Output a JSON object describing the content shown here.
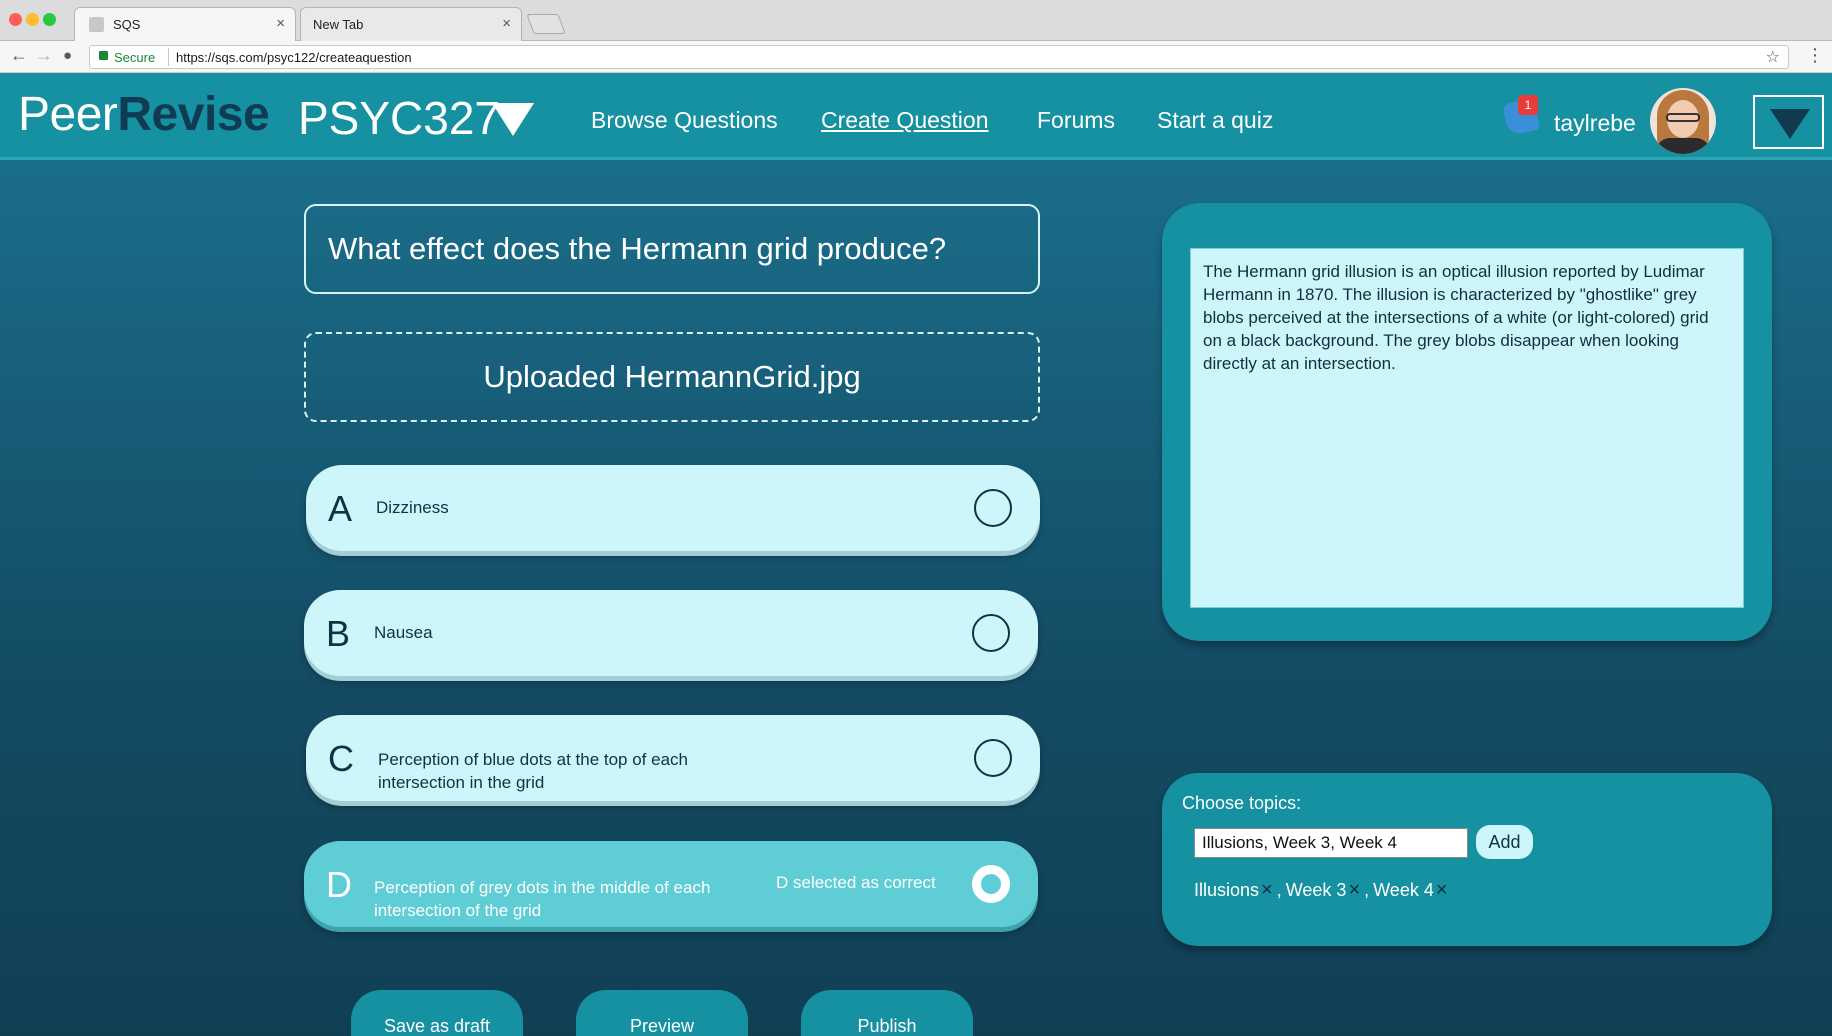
{
  "browser": {
    "tabs": [
      {
        "title": "SQS",
        "close": "×"
      },
      {
        "title": "New Tab",
        "close": "×"
      }
    ],
    "secure_label": "Secure",
    "url": "https://sqs.com/psyc122/createaquestion",
    "star": "☆",
    "menu": "⋮",
    "back": "←",
    "forward": "→",
    "reload": "●",
    "traffic_colors": [
      "#fe5f57",
      "#febc2e",
      "#28c840"
    ]
  },
  "header": {
    "logo_part1": "Peer",
    "logo_part2": "Revise",
    "course": "PSYC327",
    "nav": [
      {
        "label": "Browse Questions"
      },
      {
        "label": "Create Question"
      },
      {
        "label": "Forums"
      },
      {
        "label": "Start a quiz"
      }
    ],
    "notification_count": "1",
    "username": "taylrebe"
  },
  "question": {
    "text": "What effect does the Hermann grid produce?",
    "upload_status": "Uploaded HermannGrid.jpg"
  },
  "options": [
    {
      "letter": "A",
      "text": "Dizziness"
    },
    {
      "letter": "B",
      "text": "Nausea"
    },
    {
      "letter": "C",
      "text_line1": "Perception of blue dots at the top of each",
      "text_line2": "intersection in the grid"
    },
    {
      "letter": "D",
      "text_line1": "Perception of grey dots in the middle of each",
      "text_line2": "intersection of the grid",
      "correct_label": "D selected as correct"
    }
  ],
  "explanation": "The Hermann grid illusion is an optical illusion reported by Ludimar Hermann in 1870. The illusion is characterized by \"ghostlike\" grey blobs perceived at the intersections of a white (or light-colored) grid on a black background. The grey blobs disappear when looking directly at an intersection.",
  "topics": {
    "label": "Choose topics:",
    "input_value": "Illusions, Week 3, Week 4",
    "add_label": "Add",
    "tags": [
      {
        "label": "Illusions",
        "remove": "×"
      },
      {
        "label": "Week 3",
        "remove": "×"
      },
      {
        "label": "Week 4",
        "remove": "×"
      }
    ],
    "separator": ","
  },
  "actions": {
    "save_draft": "Save as draft",
    "preview": "Preview",
    "publish": "Publish"
  },
  "colors": {
    "header_teal": "#1591a1",
    "logo_dark": "#103b52",
    "option_light": "#cdf6fa",
    "option_selected": "#5ecdd5",
    "notification_red": "#e83b3b"
  }
}
